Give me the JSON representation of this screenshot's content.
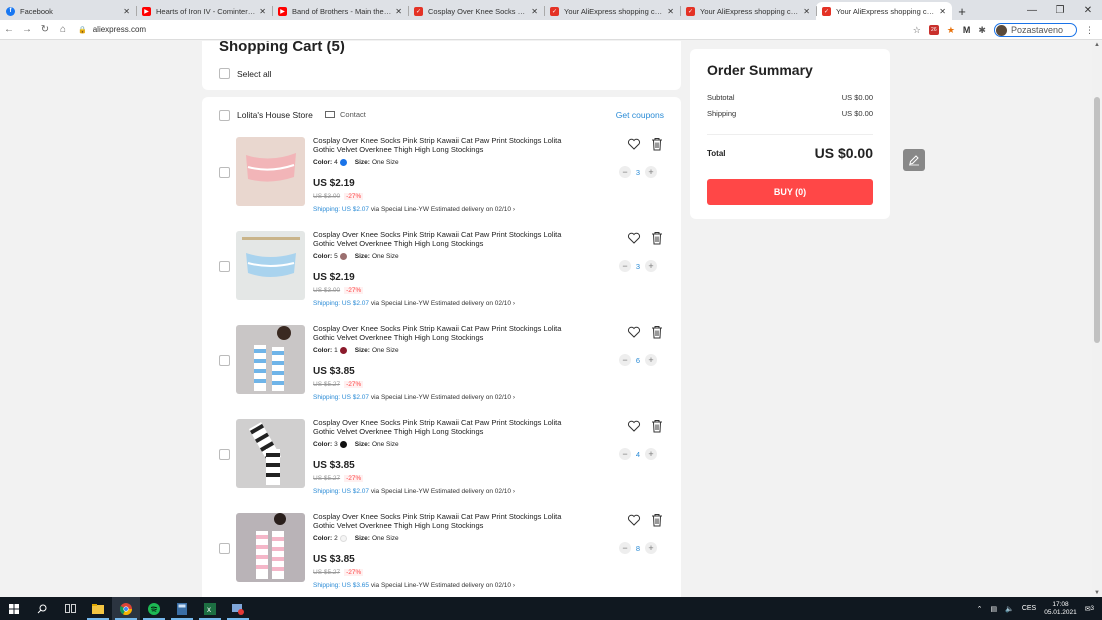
{
  "browser": {
    "tabs": [
      {
        "title": "Facebook",
        "icon": "facebook-icon",
        "color": "#1877f2",
        "active": false
      },
      {
        "title": "Hearts of Iron IV - Comintern Th",
        "icon": "youtube-icon",
        "color": "#ff0000",
        "active": false
      },
      {
        "title": "Band of Brothers - Main theme S",
        "icon": "youtube-icon",
        "color": "#ff0000",
        "active": false
      },
      {
        "title": "Cosplay Over Knee Socks Pink St",
        "icon": "aliexpress-icon",
        "color": "#e43225",
        "active": false
      },
      {
        "title": "Your AliExpress shopping cart - A",
        "icon": "aliexpress-icon",
        "color": "#e43225",
        "active": false
      },
      {
        "title": "Your AliExpress shopping cart - A",
        "icon": "aliexpress-icon",
        "color": "#e43225",
        "active": false
      },
      {
        "title": "Your AliExpress shopping cart - A",
        "icon": "aliexpress-icon",
        "color": "#e43225",
        "active": true
      }
    ],
    "url": "aliexpress.com",
    "profile_label": "Pozastaveno",
    "extension_badge": "26"
  },
  "cart": {
    "title": "Shopping Cart (5)",
    "select_all_label": "Select all",
    "store": {
      "name": "Lolita's House Store",
      "contact_label": "Contact",
      "coupons_label": "Get coupons"
    },
    "items": [
      {
        "title": "Cosplay Over Knee Socks Pink Strip Kawaii Cat Paw Print Stockings Lolita Gothic Velvet Overknee Thigh High Long Stockings",
        "color_label": "Color:",
        "color_value": "4",
        "color_swatch": "#1a73e8",
        "size_label": "Size:",
        "size_value": "One Size",
        "price": "US $2.19",
        "old_price": "US $3.00",
        "discount": "-27%",
        "shipping": "Shipping: US $2.07",
        "via": "via Special Line-YW",
        "delivery": "Estimated delivery on 02/10",
        "quantity": "3",
        "thumb": "pink-striped-socks"
      },
      {
        "title": "Cosplay Over Knee Socks Pink Strip Kawaii Cat Paw Print Stockings Lolita Gothic Velvet Overknee Thigh High Long Stockings",
        "color_label": "Color:",
        "color_value": "5",
        "color_swatch": "#9b6f6f",
        "size_label": "Size:",
        "size_value": "One Size",
        "price": "US $2.19",
        "old_price": "US $3.00",
        "discount": "-27%",
        "shipping": "Shipping: US $2.07",
        "via": "via Special Line-YW",
        "delivery": "Estimated delivery on 02/10",
        "quantity": "3",
        "thumb": "blue-striped-socks"
      },
      {
        "title": "Cosplay Over Knee Socks Pink Strip Kawaii Cat Paw Print Stockings Lolita Gothic Velvet Overknee Thigh High Long Stockings",
        "color_label": "Color:",
        "color_value": "1",
        "color_swatch": "#8b1a2b",
        "size_label": "Size:",
        "size_value": "One Size",
        "price": "US $3.85",
        "old_price": "US $5.27",
        "discount": "-27%",
        "shipping": "Shipping: US $2.07",
        "via": "via Special Line-YW",
        "delivery": "Estimated delivery on 02/10",
        "quantity": "6",
        "thumb": "blue-white-thigh-highs"
      },
      {
        "title": "Cosplay Over Knee Socks Pink Strip Kawaii Cat Paw Print Stockings Lolita Gothic Velvet Overknee Thigh High Long Stockings",
        "color_label": "Color:",
        "color_value": "3",
        "color_swatch": "#111111",
        "size_label": "Size:",
        "size_value": "One Size",
        "price": "US $3.85",
        "old_price": "US $5.27",
        "discount": "-27%",
        "shipping": "Shipping: US $2.07",
        "via": "via Special Line-YW",
        "delivery": "Estimated delivery on 02/10",
        "quantity": "4",
        "thumb": "black-white-thigh-highs"
      },
      {
        "title": "Cosplay Over Knee Socks Pink Strip Kawaii Cat Paw Print Stockings Lolita Gothic Velvet Overknee Thigh High Long Stockings",
        "color_label": "Color:",
        "color_value": "2",
        "color_swatch": "#f5f5f5",
        "size_label": "Size:",
        "size_value": "One Size",
        "price": "US $3.85",
        "old_price": "US $5.27",
        "discount": "-27%",
        "shipping": "Shipping: US $3.65",
        "via": "via Special Line-YW",
        "delivery": "Estimated delivery on 02/10",
        "quantity": "8",
        "thumb": "pink-white-thigh-highs"
      }
    ]
  },
  "summary": {
    "title": "Order Summary",
    "subtotal_label": "Subtotal",
    "subtotal_value": "US $0.00",
    "shipping_label": "Shipping",
    "shipping_value": "US $0.00",
    "total_label": "Total",
    "total_value": "US $0.00",
    "buy_label": "BUY (0)"
  },
  "taskbar": {
    "language": "CES",
    "time": "17:08",
    "date": "05.01.2021",
    "notification_count": "3"
  },
  "colors": {
    "accent_red": "#ff4747",
    "link_blue": "#2a8bd6"
  }
}
